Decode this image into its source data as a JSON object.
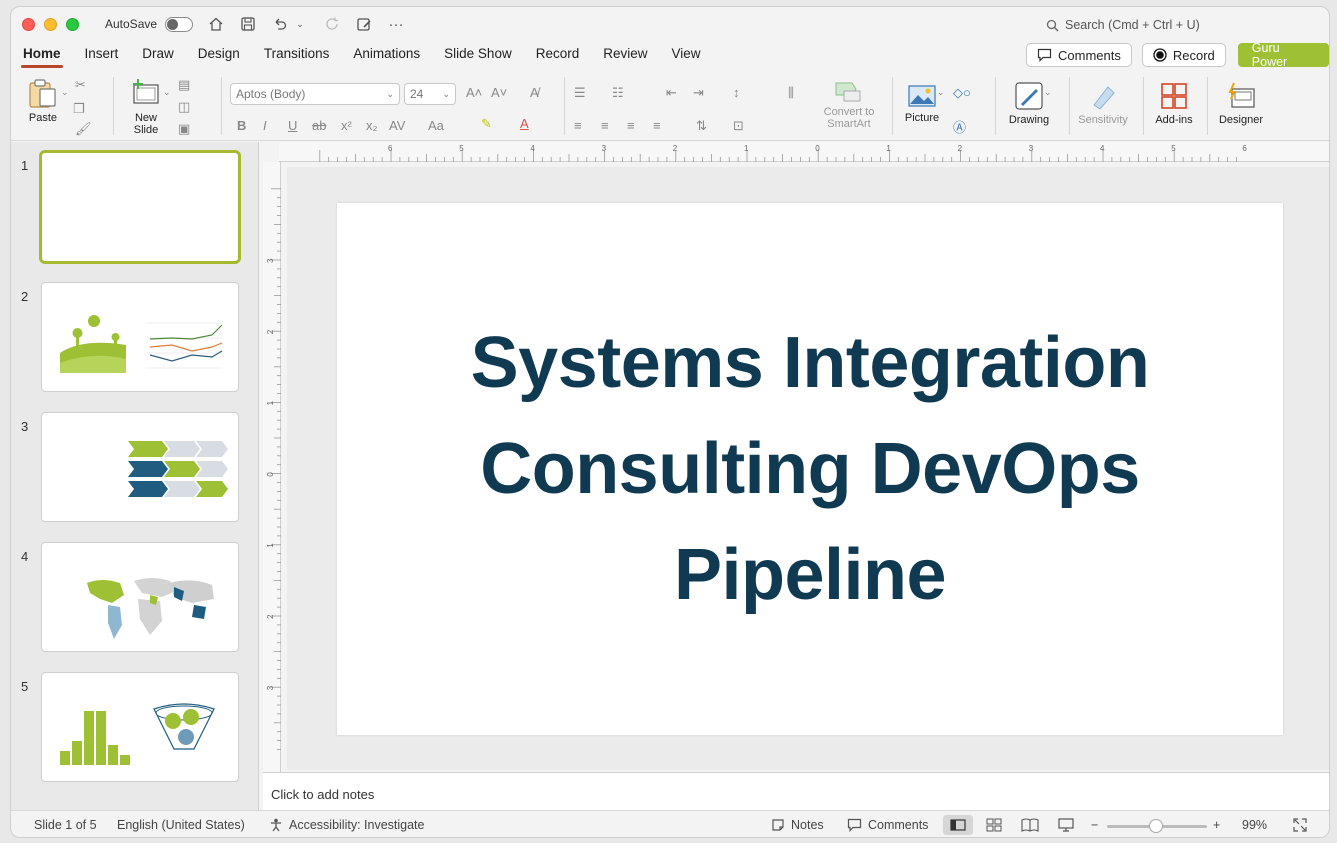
{
  "titlebar": {
    "autosave_label": "AutoSave",
    "search_placeholder": "Search (Cmd + Ctrl + U)"
  },
  "tabs": [
    {
      "label": "Home",
      "active": true
    },
    {
      "label": "Insert"
    },
    {
      "label": "Draw"
    },
    {
      "label": "Design"
    },
    {
      "label": "Transitions"
    },
    {
      "label": "Animations"
    },
    {
      "label": "Slide Show"
    },
    {
      "label": "Record"
    },
    {
      "label": "Review"
    },
    {
      "label": "View"
    }
  ],
  "header_actions": {
    "comments_label": "Comments",
    "record_label": "Record",
    "guru_label": "Guru Power"
  },
  "ribbon": {
    "paste_label": "Paste",
    "new_slide_label_1": "New",
    "new_slide_label_2": "Slide",
    "font_name": "Aptos (Body)",
    "font_size": "24",
    "convert_label_1": "Convert to",
    "convert_label_2": "SmartArt",
    "picture_label": "Picture",
    "drawing_label": "Drawing",
    "sensitivity_label": "Sensitivity",
    "addins_label": "Add-ins",
    "designer_label": "Designer",
    "bold": "B",
    "italic": "I",
    "underline": "U",
    "strike": "ab",
    "superscript": "x²",
    "subscript": "x₂",
    "char_spacing": "AV",
    "change_case": "Aa"
  },
  "thumbnails": [
    {
      "number": "1",
      "selected": true
    },
    {
      "number": "2"
    },
    {
      "number": "3"
    },
    {
      "number": "4"
    },
    {
      "number": "5"
    }
  ],
  "ruler": {
    "top_ticks": [
      "6",
      "5",
      "4",
      "3",
      "2",
      "1",
      "0",
      "1",
      "2",
      "3",
      "4",
      "5",
      "6"
    ],
    "left_ticks": [
      "3",
      "2",
      "1",
      "0",
      "1",
      "2",
      "3"
    ]
  },
  "slide": {
    "title_line_1": "Systems Integration",
    "title_line_2": "Consulting DevOps",
    "title_line_3": "Pipeline",
    "title_color": "#0f3a52"
  },
  "notes": {
    "placeholder": "Click to add notes"
  },
  "status": {
    "slide_count": "Slide 1 of 5",
    "language": "English (United States)",
    "accessibility": "Accessibility: Investigate",
    "notes_label": "Notes",
    "comments_label": "Comments",
    "zoom_percent": "99%",
    "zoom_level": 0.49
  },
  "colors": {
    "accent_tab": "#b7472a",
    "guru_green": "#9dc034",
    "thumb_select": "#a6b92f"
  }
}
